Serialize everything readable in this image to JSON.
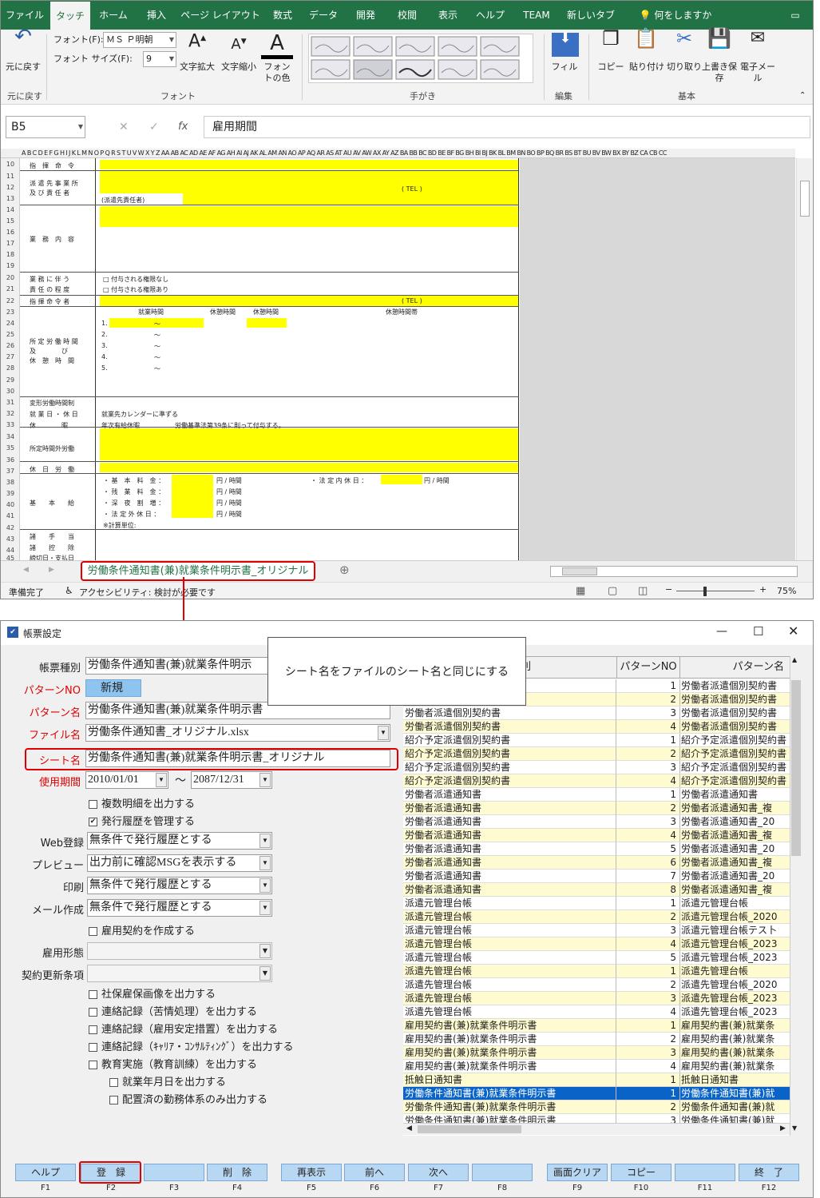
{
  "excel": {
    "tabs": [
      "ファイル",
      "タッチ",
      "ホーム",
      "挿入",
      "ページ レイアウト",
      "数式",
      "データ",
      "開発",
      "校閲",
      "表示",
      "ヘルプ",
      "TEAM",
      "新しいタブ",
      "何をしますか"
    ],
    "ribbon": {
      "undo_label": "元に戻す",
      "undo_group": "元に戻す",
      "font_label": "フォント(F):",
      "font_value": "ＭＳ Ｐ明朝",
      "size_label": "フォント サイズ(F):",
      "size_value": "9",
      "grow_label": "文字拡大",
      "shrink_label": "文字縮小",
      "font_color_label": "フォントの色",
      "font_group": "フォント",
      "pen_group": "手がき",
      "fill_label": "フィル",
      "edit_group": "編集",
      "copy_label": "コピー",
      "paste_label": "貼り付け",
      "cut_label": "切り取り",
      "save_label": "上書き保存",
      "mail_label": "電子メール",
      "basic_group": "基本"
    },
    "name_box": "B5",
    "formula": "雇用期間",
    "columns": "A B C D E F G H I  J  K  L  M  N  O  P  Q  R  S  T  U  V  W  X  Y  Z  AA AB AC AD AE AF AG AH AI AJ AK AL AM AN AO AP AQ AR AS AT AU AV AW AX AY AZ BA BB BC BD BE BF BG BH BI BJ BK BL BM BN BO BP BQ BR BS BT BU BV BW BX BY BZ CA CB CC",
    "rows": [
      "10",
      "11",
      "12",
      "13",
      "14",
      "15",
      "16",
      "17",
      "18",
      "19",
      "20",
      "21",
      "22",
      "23",
      "24",
      "25",
      "26",
      "27",
      "28",
      "29",
      "30",
      "31",
      "32",
      "33",
      "34",
      "35",
      "36",
      "37",
      "38",
      "39",
      "40",
      "41",
      "42",
      "43",
      "44",
      "45"
    ],
    "cells": {
      "r10": "指　揮　命　令",
      "r11": "派 遣 先 事 業 所",
      "r12": "及 び 責 任 者",
      "r13": "(派遣先責任者)",
      "tel": "( TEL )",
      "r16": "業　務　内　容",
      "r20": "業 務 に 伴 う",
      "r21": "責 任 の 程 度",
      "r20b": "□ 付与される権限なし",
      "r21b": "□ 付与される権限あり",
      "r22": "指 揮 命 令 者",
      "h1": "就業時間",
      "h2": "休憩時間",
      "h3": "休憩時間",
      "h4": "休憩時間帯",
      "r25": "所 定 労 働 時 間",
      "r26": "及　　　　び",
      "r27": "休　憩　時　間",
      "n1": "1.",
      "n2": "2.",
      "n3": "3.",
      "n4": "4.",
      "n5": "5.",
      "tilde": "〜",
      "r31": "変形労働時間制",
      "r32": "就 業 日 ・ 休 日",
      "r32b": "就業先カレンダーに準ずる",
      "r33": "休　　　　暇",
      "r33b": "年次有給休暇",
      "r33c": "労働基準法第39条に則って付与する。",
      "r35": "所定時間外労働",
      "r37": "休　日　労　働",
      "r38": "・ 基　本　料　金 ：",
      "r39": "・ 残　業　料　金 ：",
      "r40": "・ 深　夜　割　増 ：",
      "r41": "・ 法 定 外 休 日 ：",
      "unit": "円 / 時間",
      "r38c": "・ 法 定 内 休 日 ：",
      "r40a": "基　　本　　給",
      "r42": "※計算単位:",
      "r43": "諸　　手　　当",
      "r44": "諸　　控　　除",
      "r45": "締切日・支払日"
    },
    "sheet_tab": "労働条件通知書(兼)就業条件明示書_オリジナル",
    "status_ready": "準備完了",
    "status_access": "アクセシビリティ: 検討が必要です",
    "zoom": "75%"
  },
  "dialog": {
    "title": "帳票設定",
    "callout": "シート名をファイルのシート名と同じにする",
    "fields": {
      "kind_label": "帳票種別",
      "kind_value": "労働条件通知書(兼)就業条件明示",
      "pattern_no_label": "パターンNO",
      "pattern_no_value": "新規",
      "pattern_name_label": "パターン名",
      "pattern_name_value": "労働条件通知書(兼)就業条件明示書",
      "file_label": "ファイル名",
      "file_value": "労働条件通知書_オリジナル.xlsx",
      "sheet_label": "シート名",
      "sheet_value": "労働条件通知書(兼)就業条件明示書_オリジナル",
      "period_label": "使用期間",
      "period_from": "2010/01/01",
      "period_sep": "〜",
      "period_to": "2087/12/31",
      "cb_multi": "複数明細を出力する",
      "cb_history": "発行履歴を管理する",
      "web_label": "Web登録",
      "web_value": "無条件で発行履歴とする",
      "preview_label": "プレビュー",
      "preview_value": "出力前に確認MSGを表示する",
      "print_label": "印刷",
      "print_value": "無条件で発行履歴とする",
      "mail_label": "メール作成",
      "mail_value": "無条件で発行履歴とする",
      "cb_contract": "雇用契約を作成する",
      "emp_label": "雇用形態",
      "renew_label": "契約更新条項",
      "cb_social": "社保雇保画像を出力する",
      "cb_contact1": "連絡記録（苦情処理）を出力する",
      "cb_contact2": "連絡記録（雇用安定措置）を出力する",
      "cb_contact3": "連絡記録（ｷｬﾘｱ・ｺﾝｻﾙﾃｨﾝｸﾞ）を出力する",
      "cb_edu": "教育実施（教育訓練）を出力する",
      "cb_date": "就業年月日を出力する",
      "cb_placed": "配置済の勤務体系のみ出力する"
    },
    "grid": {
      "headers": [
        "帳票種別",
        "パターンNO",
        "パターン名"
      ],
      "rows": [
        [
          "",
          "1",
          "労働者派遣個別契約書"
        ],
        [
          "",
          "2",
          "労働者派遣個別契約書"
        ],
        [
          "労働者派遣個別契約書",
          "3",
          "労働者派遣個別契約書"
        ],
        [
          "労働者派遣個別契約書",
          "4",
          "労働者派遣個別契約書"
        ],
        [
          "紹介予定派遣個別契約書",
          "1",
          "紹介予定派遣個別契約書"
        ],
        [
          "紹介予定派遣個別契約書",
          "2",
          "紹介予定派遣個別契約書"
        ],
        [
          "紹介予定派遣個別契約書",
          "3",
          "紹介予定派遣個別契約書"
        ],
        [
          "紹介予定派遣個別契約書",
          "4",
          "紹介予定派遣個別契約書"
        ],
        [
          "労働者派遣通知書",
          "1",
          "労働者派遣通知書"
        ],
        [
          "労働者派遣通知書",
          "2",
          "労働者派遣通知書_複"
        ],
        [
          "労働者派遣通知書",
          "3",
          "労働者派遣通知書_20"
        ],
        [
          "労働者派遣通知書",
          "4",
          "労働者派遣通知書_複"
        ],
        [
          "労働者派遣通知書",
          "5",
          "労働者派遣通知書_20"
        ],
        [
          "労働者派遣通知書",
          "6",
          "労働者派遣通知書_複"
        ],
        [
          "労働者派遣通知書",
          "7",
          "労働者派遣通知書_20"
        ],
        [
          "労働者派遣通知書",
          "8",
          "労働者派遣通知書_複"
        ],
        [
          "派遣元管理台帳",
          "1",
          "派遣元管理台帳"
        ],
        [
          "派遣元管理台帳",
          "2",
          "派遣元管理台帳_2020"
        ],
        [
          "派遣元管理台帳",
          "3",
          "派遣元管理台帳テス卜"
        ],
        [
          "派遣元管理台帳",
          "4",
          "派遣元管理台帳_2023"
        ],
        [
          "派遣元管理台帳",
          "5",
          "派遣元管理台帳_2023"
        ],
        [
          "派遣先管理台帳",
          "1",
          "派遣先管理台帳"
        ],
        [
          "派遣先管理台帳",
          "2",
          "派遣先管理台帳_2020"
        ],
        [
          "派遣先管理台帳",
          "3",
          "派遣先管理台帳_2023"
        ],
        [
          "派遣先管理台帳",
          "4",
          "派遣先管理台帳_2023"
        ],
        [
          "雇用契約書(兼)就業条件明示書",
          "1",
          "雇用契約書(兼)就業条"
        ],
        [
          "雇用契約書(兼)就業条件明示書",
          "2",
          "雇用契約書(兼)就業条"
        ],
        [
          "雇用契約書(兼)就業条件明示書",
          "3",
          "雇用契約書(兼)就業条"
        ],
        [
          "雇用契約書(兼)就業条件明示書",
          "4",
          "雇用契約書(兼)就業条"
        ],
        [
          "抵触日通知書",
          "1",
          "抵触日通知書"
        ],
        [
          "労働条件通知書(兼)就業条件明示書",
          "1",
          "労働条件通知書(兼)就"
        ],
        [
          "労働条件通知書(兼)就業条件明示書",
          "2",
          "労働条件通知書(兼)就"
        ],
        [
          "労働条件通知書(兼)就業条件明示書",
          "3",
          "労働条件通知書(兼)就"
        ]
      ]
    },
    "fkeys": [
      {
        "label": "ヘルプ",
        "key": "F1"
      },
      {
        "label": "登　録",
        "key": "F2"
      },
      {
        "label": "",
        "key": "F3"
      },
      {
        "label": "削　除",
        "key": "F4"
      },
      {
        "label": "再表示",
        "key": "F5"
      },
      {
        "label": "前へ",
        "key": "F6"
      },
      {
        "label": "次へ",
        "key": "F7"
      },
      {
        "label": "",
        "key": "F8"
      },
      {
        "label": "画面クリア",
        "key": "F9"
      },
      {
        "label": "コピー",
        "key": "F10"
      },
      {
        "label": "",
        "key": "F11"
      },
      {
        "label": "終　了",
        "key": "F12"
      }
    ]
  },
  "colors": {
    "excel_green": "#217346",
    "highlight_red": "#e00000",
    "yellow": "#ffff00",
    "selection": "#0a64c8"
  }
}
